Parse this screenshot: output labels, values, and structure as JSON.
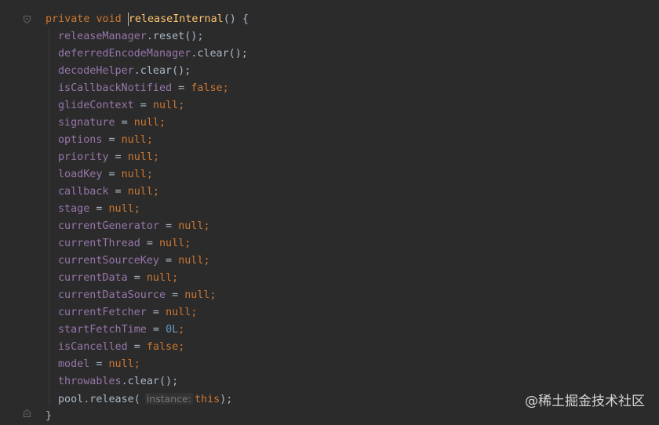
{
  "editor": {
    "header": {
      "modifier": "private",
      "return_type": "void",
      "name": "releaseInternal",
      "signature_rest": "() {"
    },
    "lines": [
      {
        "id": "release-manager",
        "a": "releaseManager",
        "b": ".reset();"
      },
      {
        "id": "deferred-encode",
        "a": "deferredEncodeManager",
        "b": ".clear();"
      },
      {
        "id": "decode-helper",
        "a": "decodeHelper",
        "b": ".clear();"
      },
      {
        "id": "is-callback",
        "a": "isCallbackNotified",
        "op": " = ",
        "val": "false",
        "end": ";"
      },
      {
        "id": "glide-context",
        "a": "glideContext",
        "op": " = ",
        "val": "null",
        "end": ";"
      },
      {
        "id": "signature",
        "a": "signature",
        "op": " = ",
        "val": "null",
        "end": ";"
      },
      {
        "id": "options",
        "a": "options",
        "op": " = ",
        "val": "null",
        "end": ";"
      },
      {
        "id": "priority",
        "a": "priority",
        "op": " = ",
        "val": "null",
        "end": ";"
      },
      {
        "id": "load-key",
        "a": "loadKey",
        "op": " = ",
        "val": "null",
        "end": ";"
      },
      {
        "id": "callback",
        "a": "callback",
        "op": " = ",
        "val": "null",
        "end": ";"
      },
      {
        "id": "stage",
        "a": "stage",
        "op": " = ",
        "val": "null",
        "end": ";"
      },
      {
        "id": "current-generator",
        "a": "currentGenerator",
        "op": " = ",
        "val": "null",
        "end": ";"
      },
      {
        "id": "current-thread",
        "a": "currentThread",
        "op": " = ",
        "val": "null",
        "end": ";"
      },
      {
        "id": "current-source-key",
        "a": "currentSourceKey",
        "op": " = ",
        "val": "null",
        "end": ";"
      },
      {
        "id": "current-data",
        "a": "currentData",
        "op": " = ",
        "val": "null",
        "end": ";"
      },
      {
        "id": "current-data-source",
        "a": "currentDataSource",
        "op": " = ",
        "val": "null",
        "end": ";"
      },
      {
        "id": "current-fetcher",
        "a": "currentFetcher",
        "op": " = ",
        "val": "null",
        "end": ";"
      },
      {
        "id": "start-fetch-time",
        "a": "startFetchTime",
        "op": " = ",
        "num": "0L",
        "end": ";"
      },
      {
        "id": "is-cancelled",
        "a": "isCancelled",
        "op": " = ",
        "val": "false",
        "end": ";"
      },
      {
        "id": "model",
        "a": "model",
        "op": " = ",
        "val": "null",
        "end": ";"
      },
      {
        "id": "throwables",
        "a": "throwables",
        "b": ".clear();"
      }
    ],
    "pool_line": {
      "obj": "pool",
      "call": ".release(",
      "hint": "instance:",
      "arg": "this",
      "end": ");"
    },
    "closing": "}"
  },
  "colors": {
    "background": "#2b2b2b",
    "keyword": "#cc7832",
    "method": "#ffc66d",
    "field": "#9876aa",
    "number": "#6897bb",
    "text": "#a9b7c6"
  },
  "watermark": "@稀土掘金技术社区"
}
